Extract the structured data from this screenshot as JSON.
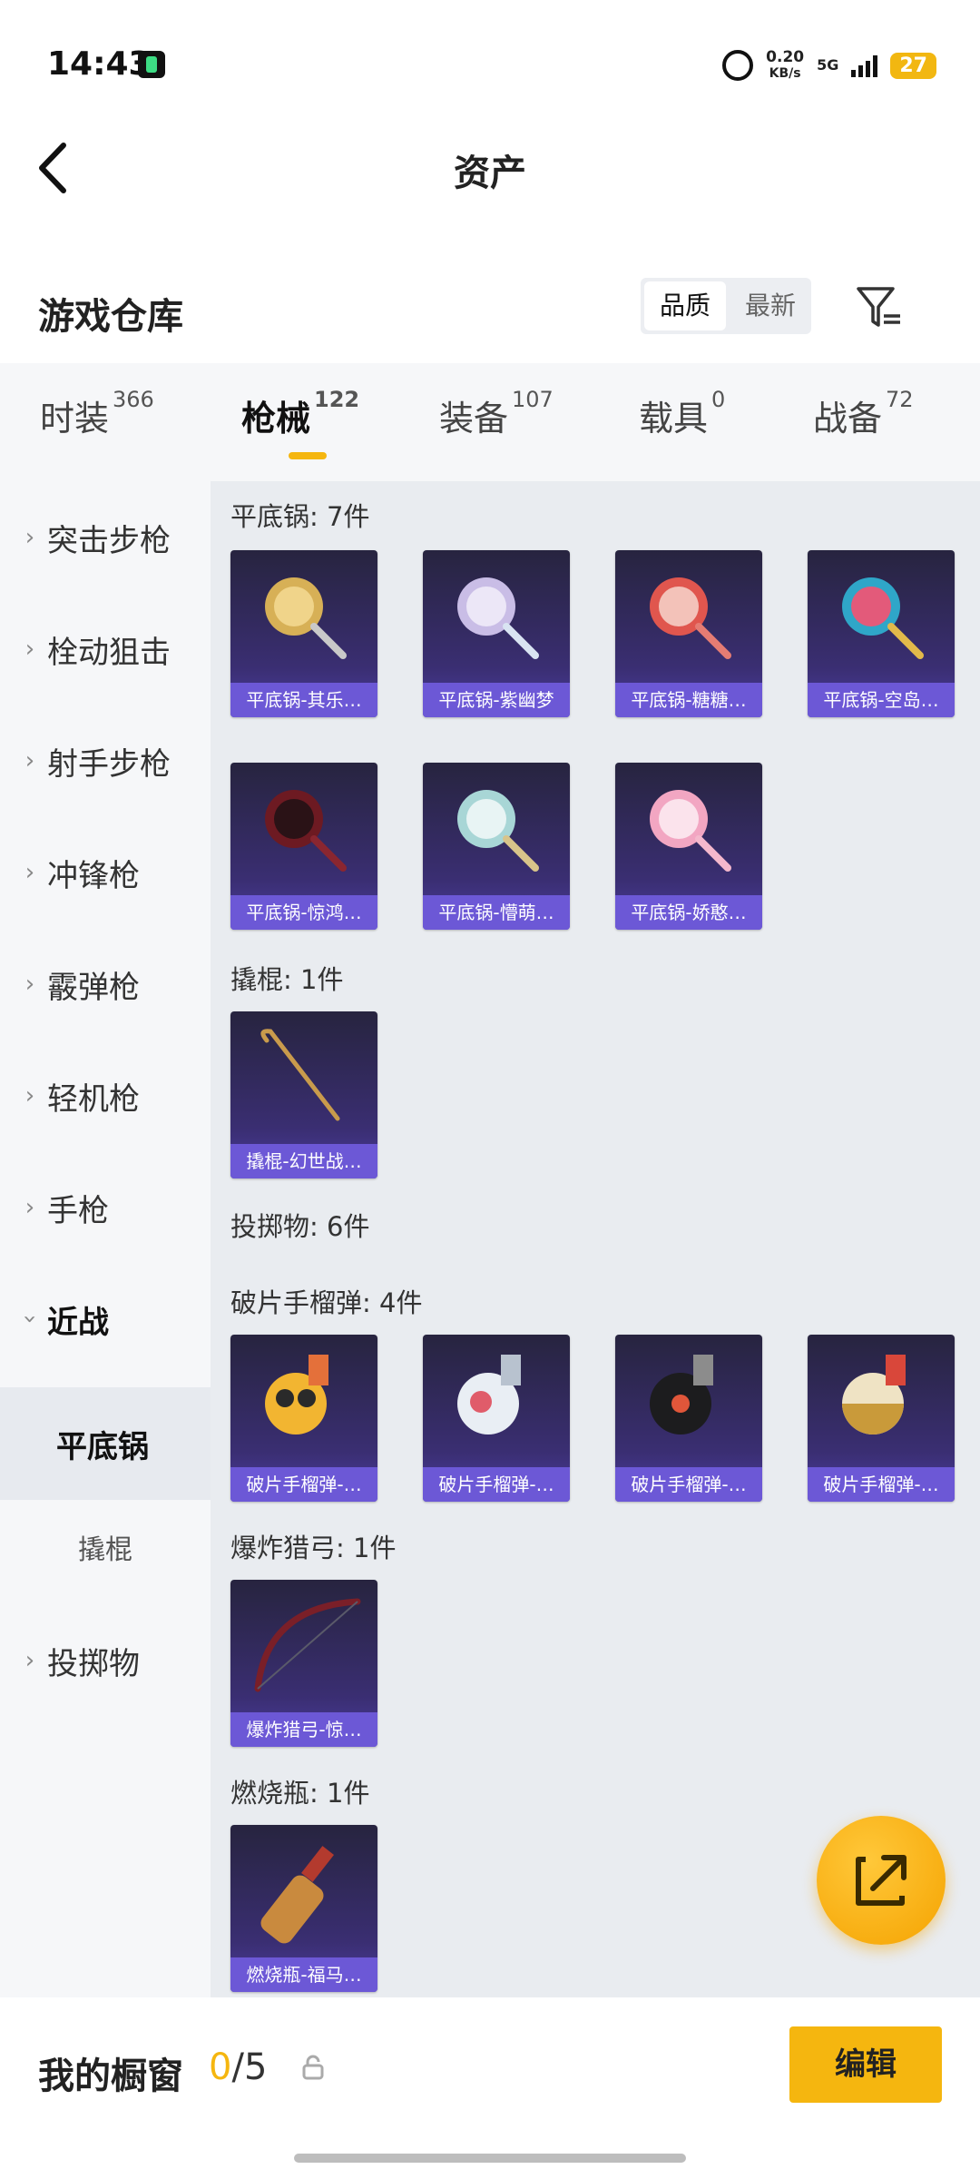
{
  "status_bar": {
    "time": "14:43",
    "net_speed_value": "0.20",
    "net_speed_unit": "KB/s",
    "network": "5G",
    "battery": "27"
  },
  "header": {
    "title": "资产",
    "back_icon": "chevron-left-icon"
  },
  "warehouse": {
    "title": "游戏仓库",
    "sort_options": [
      "品质",
      "最新"
    ],
    "active_sort": "品质",
    "filter_icon": "filter-icon"
  },
  "tabs": [
    {
      "label": "时装",
      "count": "366"
    },
    {
      "label": "枪械",
      "count": "122"
    },
    {
      "label": "装备",
      "count": "107"
    },
    {
      "label": "载具",
      "count": "0"
    },
    {
      "label": "战备",
      "count": "72"
    }
  ],
  "active_tab": "枪械",
  "sidebar": {
    "items": [
      {
        "label": "突击步枪"
      },
      {
        "label": "栓动狙击"
      },
      {
        "label": "射手步枪"
      },
      {
        "label": "冲锋枪"
      },
      {
        "label": "霰弹枪"
      },
      {
        "label": "轻机枪"
      },
      {
        "label": "手枪"
      },
      {
        "label": "近战"
      },
      {
        "label": "平底锅"
      },
      {
        "label": "撬棍"
      },
      {
        "label": "投掷物"
      }
    ]
  },
  "groups": [
    {
      "label": "平底锅: 7件",
      "items": [
        "平底锅-其乐…",
        "平底锅-紫幽梦",
        "平底锅-糖糖…",
        "平底锅-空岛…",
        "平底锅-惊鸿…",
        "平底锅-懵萌…",
        "平底锅-娇憨…"
      ]
    },
    {
      "label": "撬棍: 1件",
      "items": [
        "撬棍-幻世战…"
      ]
    },
    {
      "label": "投掷物: 6件",
      "items": []
    },
    {
      "label": "破片手榴弹: 4件",
      "items": [
        "破片手榴弹-…",
        "破片手榴弹-…",
        "破片手榴弹-…",
        "破片手榴弹-…"
      ]
    },
    {
      "label": "爆炸猎弓: 1件",
      "items": [
        "爆炸猎弓-惊…"
      ]
    },
    {
      "label": "燃烧瓶: 1件",
      "items": [
        "燃烧瓶-福马…"
      ]
    }
  ],
  "fab": {
    "icon": "share-external-icon"
  },
  "showcase": {
    "label": "我的橱窗",
    "used": "0",
    "separator": "/",
    "total": "5",
    "lock_icon": "lock-icon",
    "edit_label": "编辑"
  },
  "colors": {
    "accent": "#f5b60f",
    "card_caption": "#6c58d6",
    "card_bg": "#2e2a58"
  }
}
